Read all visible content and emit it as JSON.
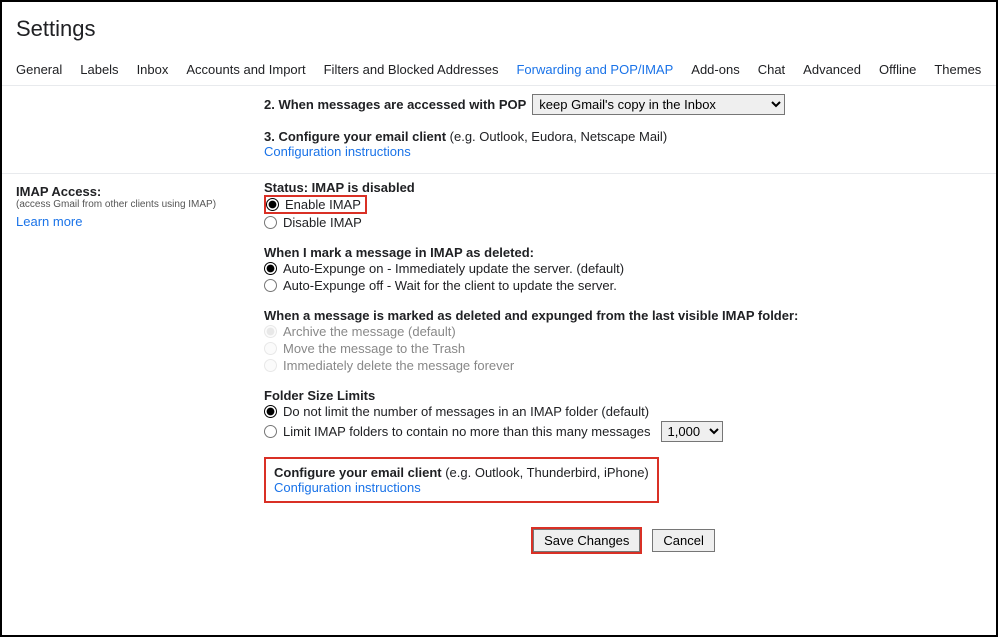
{
  "title": "Settings",
  "tabs": [
    "General",
    "Labels",
    "Inbox",
    "Accounts and Import",
    "Filters and Blocked Addresses",
    "Forwarding and POP/IMAP",
    "Add-ons",
    "Chat",
    "Advanced",
    "Offline",
    "Themes"
  ],
  "active_tab_index": 5,
  "pop": {
    "step2_prefix": "2. When messages are accessed with POP",
    "select_value": "keep Gmail's copy in the Inbox",
    "step3_bold": "3. Configure your email client",
    "step3_rest": " (e.g. Outlook, Eudora, Netscape Mail)",
    "config_link": "Configuration instructions"
  },
  "imap": {
    "left_title": "IMAP Access:",
    "left_help": "(access Gmail from other clients using IMAP)",
    "learn_more": "Learn more",
    "status": "Status: IMAP is disabled",
    "enable": "Enable IMAP",
    "disable": "Disable IMAP",
    "delete_heading": "When I mark a message in IMAP as deleted:",
    "expunge_on": "Auto-Expunge on - Immediately update the server. (default)",
    "expunge_off": "Auto-Expunge off - Wait for the client to update the server.",
    "expunged_heading": "When a message is marked as deleted and expunged from the last visible IMAP folder:",
    "archive": "Archive the message (default)",
    "trash": "Move the message to the Trash",
    "delete_forever": "Immediately delete the message forever",
    "folder_heading": "Folder Size Limits",
    "nolimit": "Do not limit the number of messages in an IMAP folder (default)",
    "limit": "Limit IMAP folders to contain no more than this many messages",
    "limit_value": "1,000",
    "config_bold": "Configure your email client",
    "config_rest": " (e.g. Outlook, Thunderbird, iPhone)",
    "config_link": "Configuration instructions"
  },
  "footer": {
    "save": "Save Changes",
    "cancel": "Cancel"
  }
}
